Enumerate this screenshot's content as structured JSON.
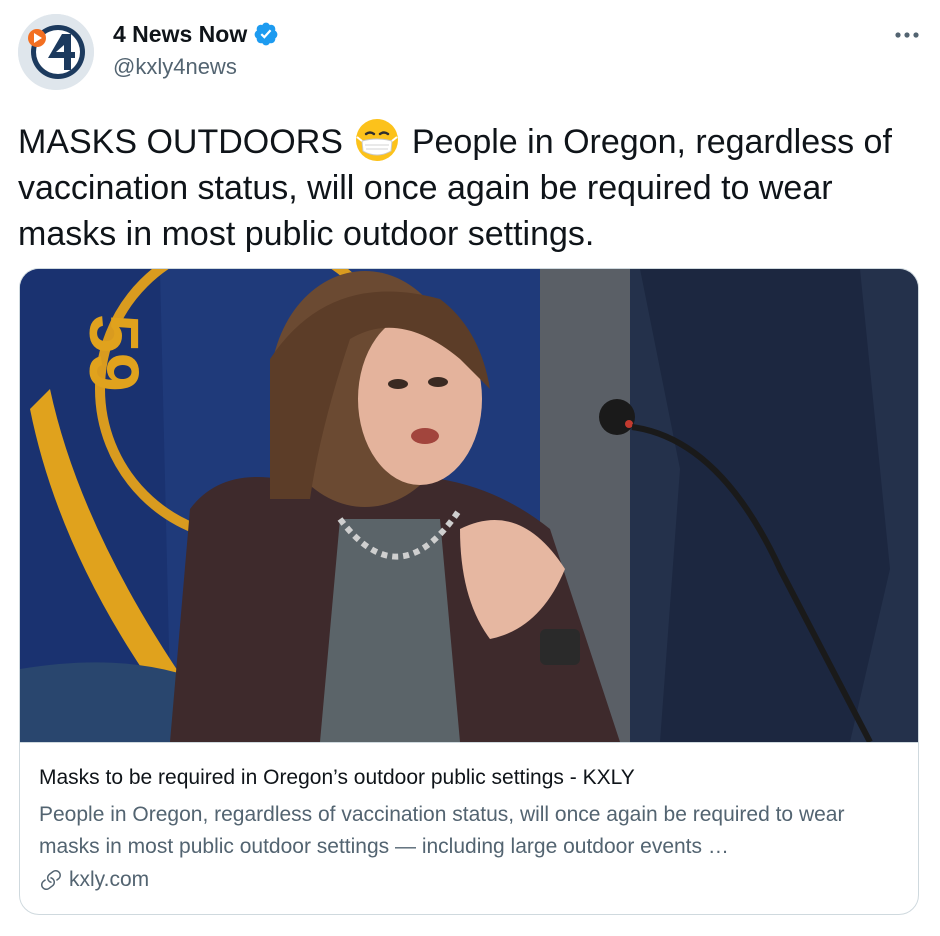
{
  "author": {
    "display_name": "4 News Now",
    "handle": "@kxly4news",
    "verified": true,
    "avatar_icon": "4-news-logo"
  },
  "tweet": {
    "text_before_emoji": "MASKS OUTDOORS",
    "emoji": "face-with-medical-mask",
    "text_after_emoji": "People in Oregon, regardless of vaccination status, will once again be required to wear masks in most public outdoor settings."
  },
  "card": {
    "title": "Masks to be required in Oregon’s outdoor public settings - KXLY",
    "description": "People in Oregon, regardless of vaccination status, will once again be required to wear masks in most public outdoor settings — including large outdoor events …",
    "domain": "kxly.com",
    "image_icon": "photo-woman-at-microphone"
  },
  "colors": {
    "accent": "#1d9bf0",
    "text_primary": "#0f1419",
    "text_secondary": "#536471",
    "border": "#cfd9de"
  }
}
